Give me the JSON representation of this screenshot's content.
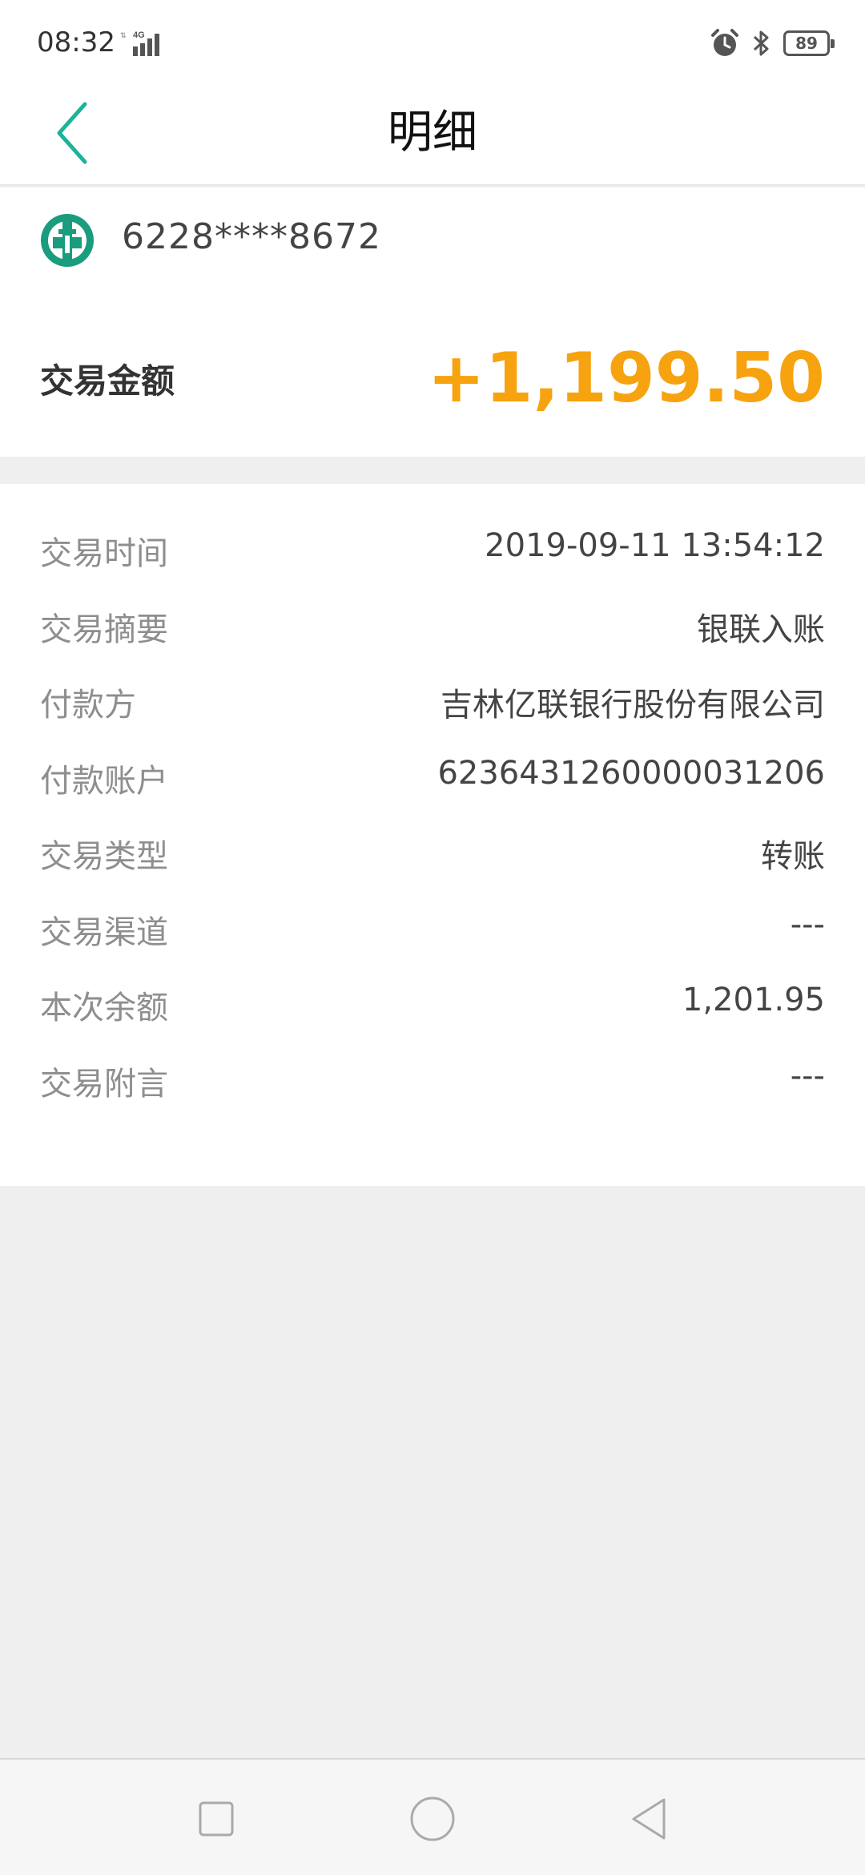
{
  "status_bar": {
    "time": "08:32",
    "network": "4G",
    "battery": "89",
    "icons": [
      "alarm-icon",
      "bluetooth-icon",
      "battery-icon"
    ]
  },
  "header": {
    "title": "明细",
    "back_icon": "chevron-left-icon"
  },
  "card": {
    "bank_logo": "abc-bank-logo",
    "card_number": "6228****8672",
    "amount_label": "交易金额",
    "amount_value": "+1,199.50",
    "amount_color": "#f7a20f"
  },
  "details": [
    {
      "label": "交易时间",
      "value": "2019-09-11 13:54:12"
    },
    {
      "label": "交易摘要",
      "value": "银联入账"
    },
    {
      "label": "付款方",
      "value": "吉林亿联银行股份有限公司"
    },
    {
      "label": "付款账户",
      "value": "6236431260000031206"
    },
    {
      "label": "交易类型",
      "value": "转账"
    },
    {
      "label": "交易渠道",
      "value": "---"
    },
    {
      "label": "本次余额",
      "value": "1,201.95"
    },
    {
      "label": "交易附言",
      "value": "---"
    }
  ],
  "nav_bar": {
    "buttons": [
      "recents-square-icon",
      "home-circle-icon",
      "back-triangle-icon"
    ]
  },
  "colors": {
    "accent": "#1bb39a",
    "amount": "#f7a20f",
    "background": "#efefef"
  }
}
